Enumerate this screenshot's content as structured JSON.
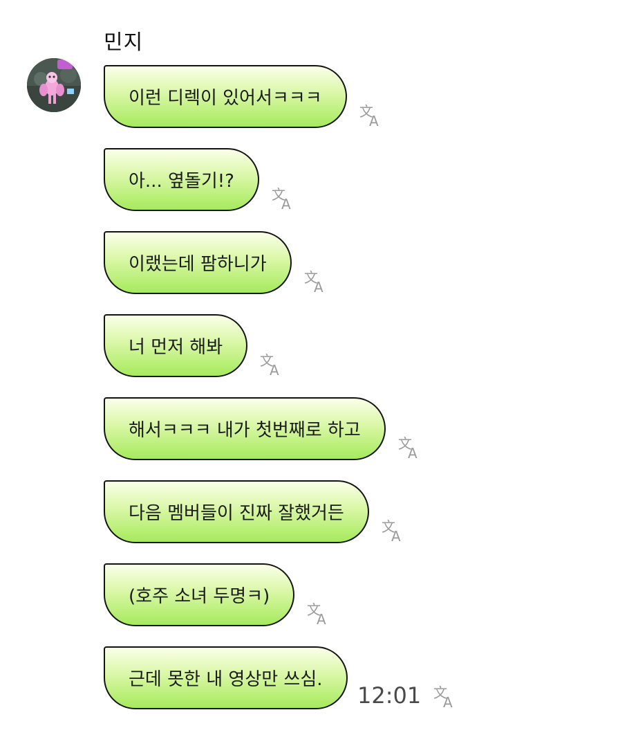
{
  "chat": {
    "sender_name": "민지",
    "messages": [
      {
        "text": "이런 디렉이 있어서ㅋㅋㅋ"
      },
      {
        "text": "아... 옆돌기!?"
      },
      {
        "text": "이랬는데 팜하니가"
      },
      {
        "text": "너 먼저 해봐"
      },
      {
        "text": "해서ㅋㅋㅋ 내가 첫번째로 하고"
      },
      {
        "text": "다음 멤버들이 진짜 잘했거든"
      },
      {
        "text": "(호주 소녀 두명ㅋ)"
      },
      {
        "text": "근데 못한 내 영상만 쓰심."
      }
    ],
    "last_timestamp": "12:01"
  },
  "icons": {
    "translate": "translate-icon",
    "avatar": "avatar"
  },
  "colors": {
    "bubble_top": "#fbffe9",
    "bubble_bottom": "#a6ea5c",
    "bubble_border": "#141414",
    "icon_gray": "#9a9a9a"
  }
}
